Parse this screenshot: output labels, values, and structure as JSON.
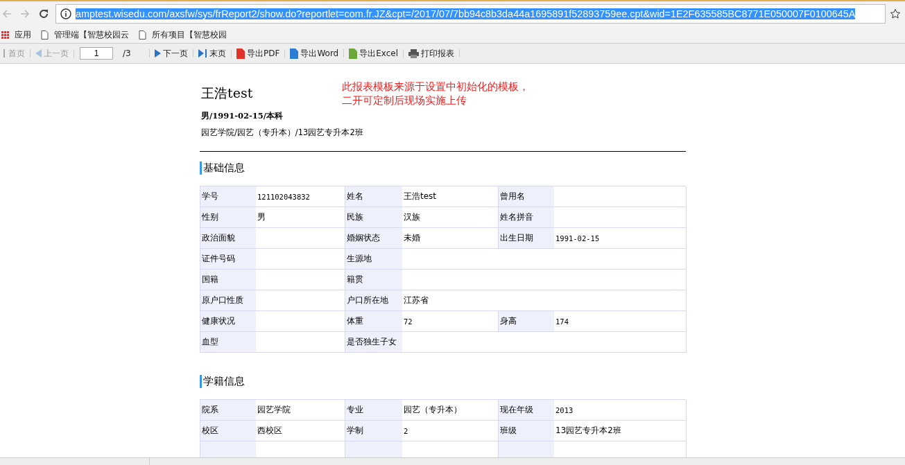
{
  "browser": {
    "url": "amptest.wisedu.com/axsfw/sys/frReport2/show.do?reportlet=com.fr.JZ&cpt=/2017/07/7bb94c8b3da44a1695891f52893759ee.cpt&wid=1E2F635585BC8771E050007F0100645A",
    "url_selected": true,
    "bookmarks": [
      {
        "kind": "apps",
        "label": "应用"
      },
      {
        "kind": "page",
        "label": "管理端【智慧校园云"
      },
      {
        "kind": "page",
        "label": "所有项目【智慧校园"
      }
    ]
  },
  "toolbar": {
    "items": [
      {
        "kind": "first",
        "label": "首页",
        "disabled": true
      },
      {
        "kind": "prev",
        "label": "上一页",
        "disabled": true
      },
      {
        "kind": "page",
        "value": "1",
        "total": "/3"
      },
      {
        "kind": "next",
        "label": "下一页",
        "disabled": false
      },
      {
        "kind": "last",
        "label": "末页",
        "disabled": false
      },
      {
        "kind": "pdf",
        "label": "导出PDF",
        "disabled": false
      },
      {
        "kind": "word",
        "label": "导出Word",
        "disabled": false
      },
      {
        "kind": "excel",
        "label": "导出Excel",
        "disabled": false
      },
      {
        "kind": "print",
        "label": "打印报表",
        "disabled": false
      }
    ]
  },
  "report": {
    "name": "王浩test",
    "summary": "男/1991-02-15/本科",
    "affiliation": "园艺学院/园艺（专升本）/13园艺专升本2班",
    "note": [
      "此报表模板来源于设置中初始化的模板，",
      "二开可定制后现场实施上传"
    ],
    "sections": [
      {
        "title": "基础信息",
        "rows": [
          [
            {
              "kind": "label",
              "text": "学号"
            },
            {
              "kind": "value",
              "text": "121102043832"
            },
            {
              "kind": "label",
              "text": "姓名"
            },
            {
              "kind": "value",
              "text": "王浩test"
            },
            {
              "kind": "label",
              "text": "曾用名"
            },
            {
              "kind": "value"
            }
          ],
          [
            {
              "kind": "label",
              "text": "性别"
            },
            {
              "kind": "value",
              "text": "男"
            },
            {
              "kind": "label",
              "text": "民族"
            },
            {
              "kind": "value",
              "text": "汉族"
            },
            {
              "kind": "label",
              "text": "姓名拼音"
            },
            {
              "kind": "value"
            }
          ],
          [
            {
              "kind": "label",
              "text": "政治面貌"
            },
            {
              "kind": "value"
            },
            {
              "kind": "label",
              "text": "婚姻状态"
            },
            {
              "kind": "value",
              "text": "未婚"
            },
            {
              "kind": "label",
              "text": "出生日期"
            },
            {
              "kind": "value",
              "text": "1991-02-15"
            }
          ],
          [
            {
              "kind": "label",
              "text": "证件号码"
            },
            {
              "kind": "value"
            },
            {
              "kind": "label",
              "text": "生源地"
            },
            {
              "kind": "value"
            }
          ],
          [
            {
              "kind": "label",
              "text": "国籍"
            },
            {
              "kind": "value"
            },
            {
              "kind": "label",
              "text": "籍贯"
            },
            {
              "kind": "value"
            }
          ],
          [
            {
              "kind": "label",
              "text": "原户口性质"
            },
            {
              "kind": "value"
            },
            {
              "kind": "label",
              "text": "户口所在地"
            },
            {
              "kind": "value",
              "text": "江苏省"
            }
          ],
          [
            {
              "kind": "label",
              "text": "健康状况"
            },
            {
              "kind": "value"
            },
            {
              "kind": "label",
              "text": "体重"
            },
            {
              "kind": "value",
              "text": "72"
            },
            {
              "kind": "label",
              "text": "身高"
            },
            {
              "kind": "value",
              "text": "174"
            }
          ],
          [
            {
              "kind": "label",
              "text": "血型"
            },
            {
              "kind": "value"
            },
            {
              "kind": "label",
              "text": "是否独生子女"
            },
            {
              "kind": "value"
            }
          ]
        ]
      },
      {
        "title": "学籍信息",
        "rows": [
          [
            {
              "kind": "label",
              "text": "院系"
            },
            {
              "kind": "value",
              "text": "园艺学院"
            },
            {
              "kind": "label",
              "text": "专业"
            },
            {
              "kind": "value",
              "text": "园艺（专升本）"
            },
            {
              "kind": "label",
              "text": "现在年级"
            },
            {
              "kind": "value",
              "text": "2013"
            }
          ],
          [
            {
              "kind": "label",
              "text": "校区"
            },
            {
              "kind": "value",
              "text": "西校区"
            },
            {
              "kind": "label",
              "text": "学制"
            },
            {
              "kind": "value",
              "text": "2"
            },
            {
              "kind": "label",
              "text": "班级"
            },
            {
              "kind": "value",
              "text": "13园艺专升本2班"
            }
          ],
          [
            {
              "kind": "label"
            },
            {
              "kind": "value"
            },
            {
              "kind": "label"
            },
            {
              "kind": "value"
            },
            {
              "kind": "label"
            },
            {
              "kind": "value"
            }
          ]
        ]
      }
    ]
  }
}
